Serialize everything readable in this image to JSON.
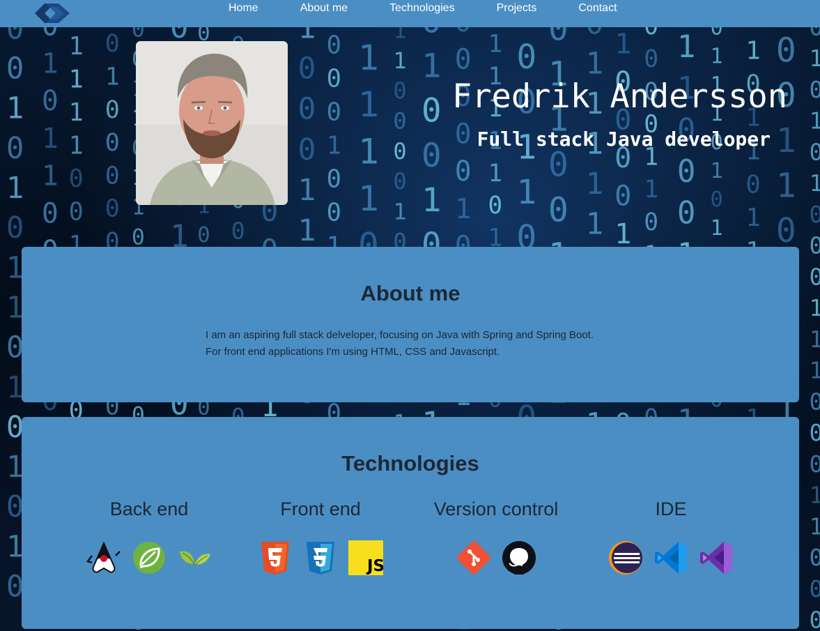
{
  "nav": {
    "logo": "chevron-logo",
    "links": [
      "Home",
      "About me",
      "Technologies",
      "Projects",
      "Contact"
    ]
  },
  "hero": {
    "name": "Fredrik Andersson",
    "role": "Full stack Java developer"
  },
  "about": {
    "title": "About me",
    "lines": [
      "I am an aspiring full stack delveloper, focusing on Java with Spring and Spring Boot.",
      "For front end applications I'm using HTML, CSS and Javascript."
    ]
  },
  "technologies": {
    "title": "Technologies",
    "groups": [
      {
        "title": "Back end",
        "icons": [
          "java-duke-icon",
          "spring-icon",
          "spring-boot-leaf-icon"
        ]
      },
      {
        "title": "Front end",
        "icons": [
          "html5-icon",
          "css3-icon",
          "javascript-icon"
        ]
      },
      {
        "title": "Version control",
        "icons": [
          "git-icon",
          "github-icon"
        ]
      },
      {
        "title": "IDE",
        "icons": [
          "eclipse-icon",
          "vscode-icon",
          "visual-studio-icon"
        ]
      }
    ]
  },
  "colors": {
    "nav_bg": "#4b8ec4",
    "card_bg": "#4b8ec4",
    "heading_text": "#1d2733",
    "hero_text": "#ffffff"
  }
}
